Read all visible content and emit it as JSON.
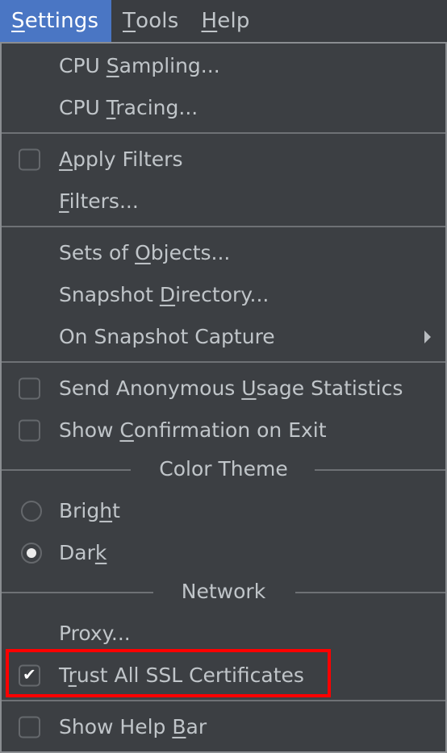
{
  "menubar": {
    "items": [
      {
        "pre": "",
        "mnemonic": "S",
        "post": "ettings",
        "active": true
      },
      {
        "pre": "",
        "mnemonic": "T",
        "post": "ools",
        "active": false
      },
      {
        "pre": "",
        "mnemonic": "H",
        "post": "elp",
        "active": false
      }
    ]
  },
  "settings_menu": {
    "cpu_sampling": {
      "pre": "CPU ",
      "mnemonic": "S",
      "post": "ampling..."
    },
    "cpu_tracing": {
      "pre": "CPU ",
      "mnemonic": "T",
      "post": "racing..."
    },
    "apply_filters": {
      "pre": "",
      "mnemonic": "A",
      "post": "pply Filters",
      "checked": false
    },
    "filters": {
      "pre": "",
      "mnemonic": "F",
      "post": "ilters..."
    },
    "sets_of_objects": {
      "pre": "Sets of ",
      "mnemonic": "O",
      "post": "bjects..."
    },
    "snapshot_directory": {
      "pre": "Snapshot ",
      "mnemonic": "D",
      "post": "irectory..."
    },
    "on_snapshot_capture": {
      "pre": "On Snapshot Capture",
      "mnemonic": "",
      "post": "",
      "submenu_icon": "chevron-right-icon"
    },
    "send_usage_stats": {
      "pre": "Send Anonymous ",
      "mnemonic": "U",
      "post": "sage Statistics",
      "checked": false
    },
    "show_confirmation": {
      "pre": "Show ",
      "mnemonic": "C",
      "post": "onfirmation on Exit",
      "checked": false
    },
    "color_theme_header": "Color Theme",
    "theme_bright": {
      "pre": "Brig",
      "mnemonic": "h",
      "post": "t",
      "selected": false
    },
    "theme_dark": {
      "pre": "Dar",
      "mnemonic": "k",
      "post": "",
      "selected": true
    },
    "network_header": "Network",
    "proxy": {
      "pre": "Proxy...",
      "mnemonic": "",
      "post": ""
    },
    "trust_ssl": {
      "pre": "T",
      "mnemonic": "r",
      "post": "ust All SSL Certificates",
      "checked": true,
      "check_glyph": "✔"
    },
    "show_help_bar": {
      "pre": "Show Help ",
      "mnemonic": "B",
      "post": "ar",
      "checked": false
    }
  },
  "annotation": {
    "highlight_color": "#ff0000",
    "target": "trust_ssl"
  },
  "colors": {
    "menubar_active": "#4a76c4",
    "menu_bg": "#3c3f43",
    "text": "#c0c5c9"
  }
}
